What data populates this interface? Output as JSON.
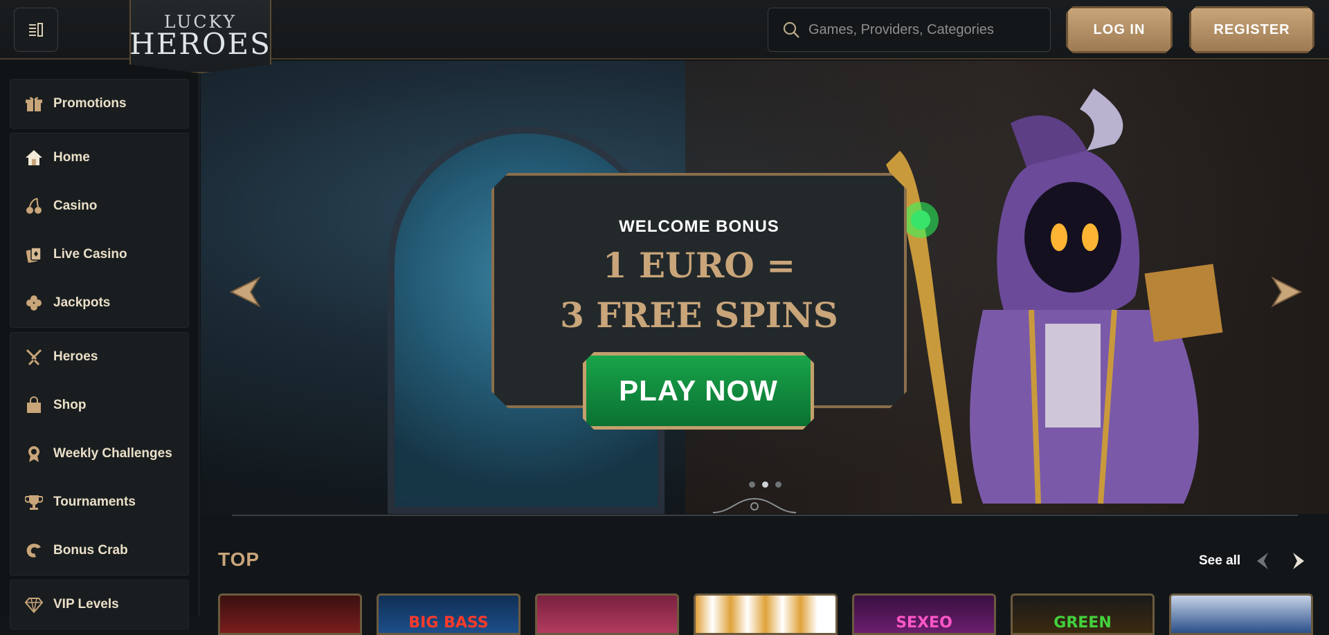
{
  "header": {
    "logo_line1": "LUCKY",
    "logo_line2": "HEROES",
    "search_placeholder": "Games, Providers, Categories",
    "login_label": "LOG IN",
    "register_label": "REGISTER"
  },
  "sidebar": {
    "groups": [
      [
        {
          "label": "Promotions",
          "icon": "gift-icon"
        }
      ],
      [
        {
          "label": "Home",
          "icon": "home-icon"
        },
        {
          "label": "Casino",
          "icon": "cherries-icon"
        },
        {
          "label": "Live Casino",
          "icon": "cards-icon"
        },
        {
          "label": "Jackpots",
          "icon": "clover-icon"
        }
      ],
      [
        {
          "label": "Heroes",
          "icon": "crossed-swords-icon"
        },
        {
          "label": "Shop",
          "icon": "shopping-bag-icon"
        },
        {
          "label": "Weekly Challenges",
          "icon": "medal-icon"
        },
        {
          "label": "Tournaments",
          "icon": "trophy-icon"
        },
        {
          "label": "Bonus Crab",
          "icon": "crab-claw-icon"
        }
      ],
      [
        {
          "label": "VIP Levels",
          "icon": "diamond-icon"
        }
      ]
    ]
  },
  "banner": {
    "welcome": "WELCOME BONUS",
    "line1": "1 EURO =",
    "line2": "3 FREE SPINS",
    "cta": "PLAY NOW",
    "slides_total": 3,
    "active_slide": 2
  },
  "top_section": {
    "title": "TOP",
    "see_all": "See all",
    "tiles": [
      {
        "text": "",
        "color": "#7a1d1d"
      },
      {
        "text": "BIG BASS",
        "color": "#1d4e8a"
      },
      {
        "text": "",
        "color": "#b23b5e"
      },
      {
        "text": "",
        "color": "#c98a2a"
      },
      {
        "text": "SEXEO",
        "color": "#6a1f6e"
      },
      {
        "text": "GREEN",
        "color": "#2d7a2a"
      },
      {
        "text": "",
        "color": "#2a4f8a"
      }
    ]
  },
  "colors": {
    "accent_gold": "#c9a57a",
    "cta_green": "#14913f",
    "bg": "#121619"
  }
}
